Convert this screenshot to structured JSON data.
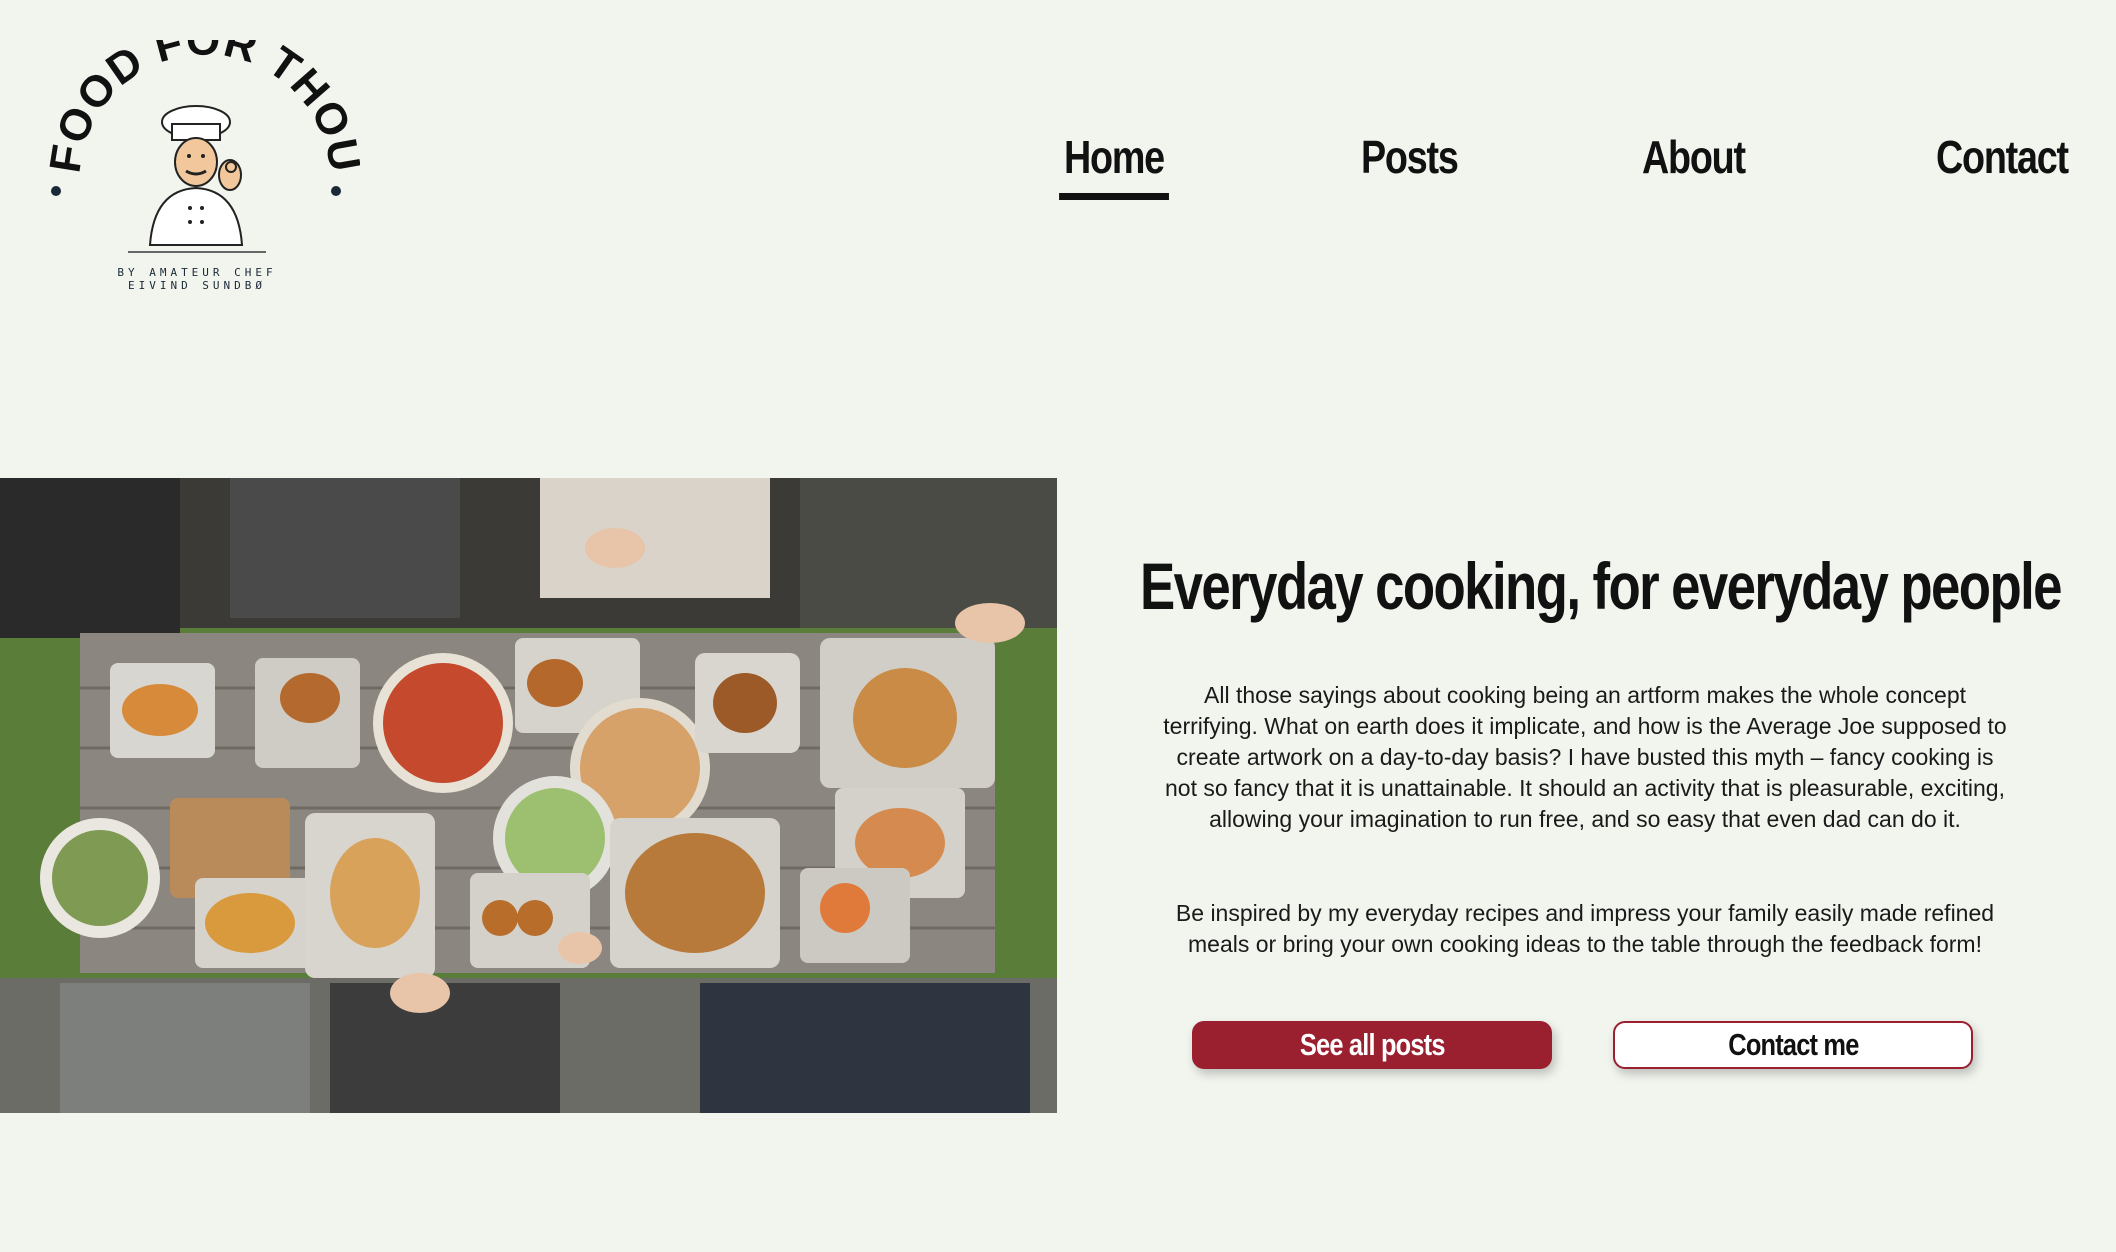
{
  "logo": {
    "title": "FOOD FOR THOUGHT",
    "tagline_line1": "BY AMATEUR CHEF",
    "tagline_line2": "EIVIND SUNDBØ"
  },
  "nav": {
    "items": [
      {
        "label": "Home",
        "active": true
      },
      {
        "label": "Posts",
        "active": false
      },
      {
        "label": "About",
        "active": false
      },
      {
        "label": "Contact",
        "active": false
      }
    ]
  },
  "hero": {
    "title": "Everyday cooking, for everyday people",
    "paragraph1": "All those sayings about cooking being an artform makes the whole concept terrifying. What on earth does it implicate, and how is the Average Joe supposed to create artwork on a day-to-day basis? I have busted this myth – fancy cooking is not so fancy that it is unattainable. It should an activity that is pleasurable, exciting, allowing your imagination to run free, and so easy that even dad can do it.",
    "paragraph2": "Be inspired by my everyday recipes and impress your family easily made refined meals or bring your own cooking ideas to the table through the feedback form!",
    "primary_button": "See all posts",
    "secondary_button": "Contact me"
  },
  "colors": {
    "background": "#f1f5ee",
    "accent": "#9a1f2f",
    "text": "#111111"
  }
}
